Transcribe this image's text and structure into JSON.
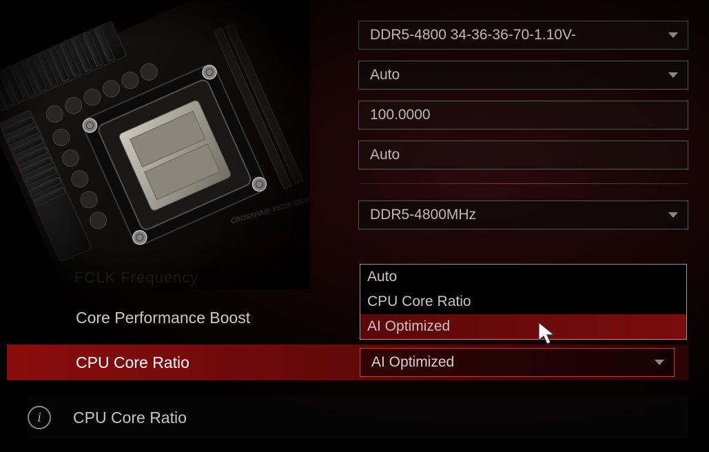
{
  "settings": {
    "memory_profile": {
      "value": "DDR5-4800 34-36-36-70-1.10V-"
    },
    "mode": {
      "value": "Auto"
    },
    "bclk": {
      "value": "100.0000"
    },
    "bclk_mode": {
      "value": "Auto"
    },
    "memory_speed": {
      "value": "DDR5-4800MHz"
    },
    "cpu_ratio_selected": {
      "value": "AI Optimized"
    }
  },
  "labels": {
    "core_perf_boost": "Core Performance Boost",
    "cpu_core_ratio": "CPU Core Ratio",
    "ghost": "FCLK Frequency"
  },
  "dropdown": {
    "items": [
      "Auto",
      "CPU Core Ratio",
      "AI Optimized"
    ],
    "hovered": 2
  },
  "help": {
    "text": "CPU Core Ratio"
  }
}
